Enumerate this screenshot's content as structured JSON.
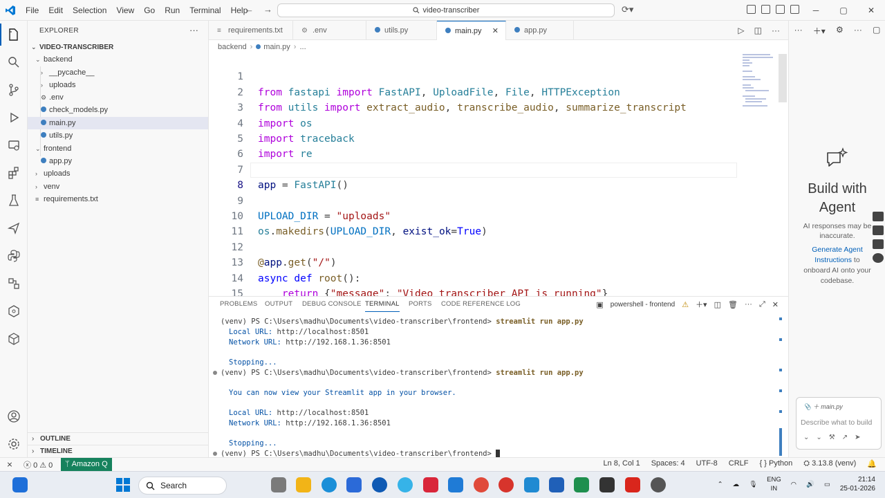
{
  "menu": [
    "File",
    "Edit",
    "Selection",
    "View",
    "Go",
    "Run",
    "Terminal",
    "Help"
  ],
  "command_center": "video-transcriber",
  "explorer": {
    "title": "EXPLORER",
    "root": "VIDEO-TRANSCRIBER",
    "items": [
      {
        "label": "backend"
      },
      {
        "label": "__pycache__"
      },
      {
        "label": "uploads"
      },
      {
        "label": ".env"
      },
      {
        "label": "check_models.py"
      },
      {
        "label": "main.py"
      },
      {
        "label": "utils.py"
      },
      {
        "label": "frontend"
      },
      {
        "label": "app.py"
      },
      {
        "label": "uploads"
      },
      {
        "label": "venv"
      },
      {
        "label": "requirements.txt"
      }
    ],
    "outline": "OUTLINE",
    "timeline": "TIMELINE"
  },
  "tabs": [
    "requirements.txt",
    ".env",
    "utils.py",
    "main.py",
    "app.py"
  ],
  "breadcrumb": {
    "folder": "backend",
    "file": "main.py"
  },
  "code": {
    "lines": [
      "1",
      "2",
      "3",
      "4",
      "5",
      "6",
      "7",
      "8",
      "9",
      "10",
      "11",
      "12",
      "13",
      "14",
      "15"
    ],
    "t": {
      "from": "from",
      "import": "import",
      "fastapi": "fastapi",
      "FastAPI": "FastAPI",
      "UploadFile": "UploadFile",
      "File": "File",
      "HTTPException": "HTTPException",
      "utils": "utils",
      "extract_audio": "extract_audio",
      "transcribe_audio": "transcribe_audio",
      "summarize_transcript": "summarize_transcript",
      "os": "os",
      "traceback": "traceback",
      "re": "re",
      "app": "app",
      "FastAPI_call": "FastAPI",
      "UPLOAD_DIR": "UPLOAD_DIR",
      "uploads_str": "\"uploads\"",
      "makedirs": "makedirs",
      "exist_ok": "exist_ok",
      "True": "True",
      "get": "get",
      "slash": "\"/\"",
      "async": "async",
      "def": "def",
      "root": "root",
      "return": "return",
      "message": "\"message\"",
      "msg_val": "\"Video transcriber API is running\""
    }
  },
  "panel": {
    "tabs": [
      "PROBLEMS",
      "OUTPUT",
      "DEBUG CONSOLE",
      "TERMINAL",
      "PORTS",
      "CODE REFERENCE LOG"
    ],
    "terminal_name": "powershell - frontend",
    "prompt": "(venv) PS C:\\Users\\madhu\\Documents\\video-transcriber\\frontend>",
    "command": "streamlit run app.py",
    "local_label": "Local URL:",
    "local_url": "http://localhost:8501",
    "network_label": "Network URL:",
    "network_url": "http://192.168.1.36:8501",
    "stopping": "Stopping...",
    "info": "You can now view your Streamlit app in your browser."
  },
  "chat": {
    "title": "Build with Agent",
    "sub": "AI responses may be inaccurate.",
    "link": "Generate Agent Instructions",
    "link_rest": " to onboard AI onto your codebase.",
    "chip": "main.py",
    "placeholder": "Describe what to build"
  },
  "status": {
    "errors": "0",
    "warnings": "0",
    "amazon": "Amazon Q",
    "position": "Ln 8, Col 1",
    "spaces": "Spaces: 4",
    "encoding": "UTF-8",
    "eol": "CRLF",
    "lang": "Python",
    "version": "3.13.8 (venv)"
  },
  "taskbar": {
    "search": "Search",
    "lang": "ENG",
    "region": "IN",
    "time": "21:14",
    "date": "25-01-2026"
  }
}
